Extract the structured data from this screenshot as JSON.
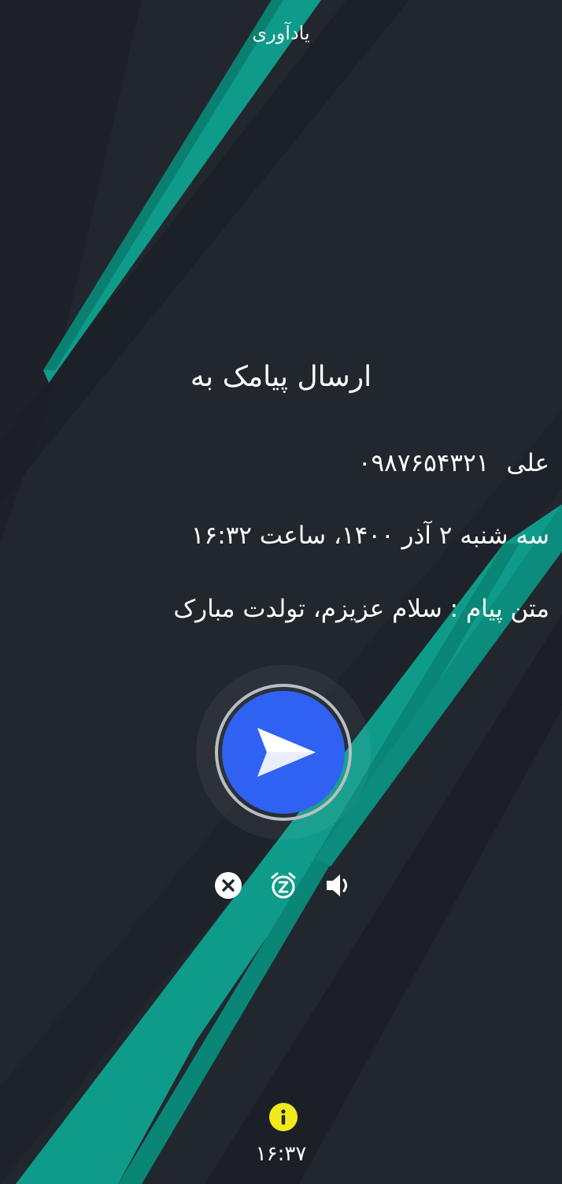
{
  "header": {
    "title": "یادآوری"
  },
  "reminder": {
    "heading": "ارسال پیامک به",
    "contact_name": "علی",
    "contact_number": "۰۹۸۷۶۵۴۳۲۱",
    "datetime": "سه شنبه ۲ آذر ۱۴۰۰، ساعت ۱۶:۳۲",
    "message": "متن پیام : سلام عزیزم، تولدت مبارک"
  },
  "actions": {
    "send_icon": "send-icon",
    "close_icon": "close-icon",
    "snooze_icon": "snooze-alarm-icon",
    "volume_icon": "volume-icon",
    "info_icon": "info-icon"
  },
  "footer": {
    "time": "۱۶:۳۷"
  },
  "colors": {
    "background": "#22272e",
    "accent_teal": "#0f9b8a",
    "send_button": "#2f62f2",
    "info_yellow": "#f2ea1a"
  }
}
